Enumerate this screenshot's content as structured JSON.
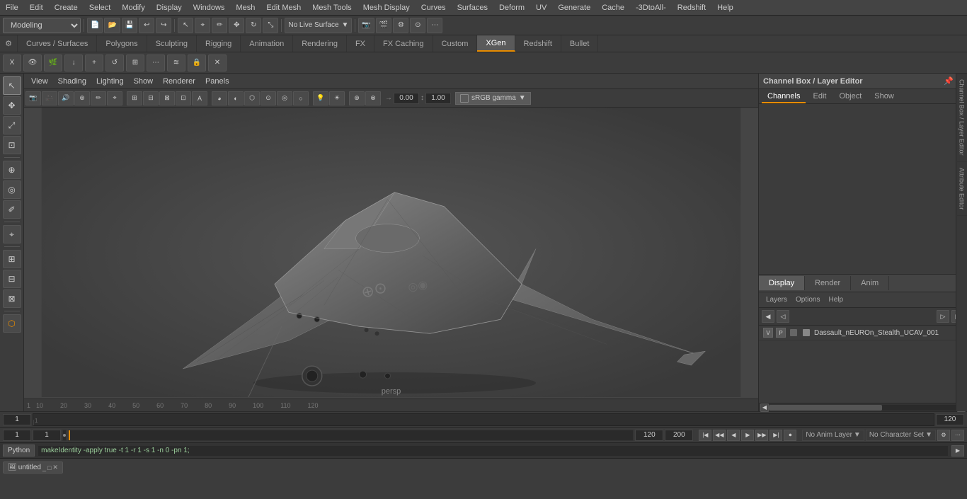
{
  "menubar": {
    "items": [
      "File",
      "Edit",
      "Create",
      "Select",
      "Modify",
      "Display",
      "Windows",
      "Mesh",
      "Edit Mesh",
      "Mesh Tools",
      "Mesh Display",
      "Curves",
      "Surfaces",
      "Deform",
      "UV",
      "Generate",
      "Cache",
      "-3DtoAll-",
      "Redshift",
      "Help"
    ]
  },
  "toolbar1": {
    "mode_label": "Modeling",
    "live_surface": "No Live Surface"
  },
  "tabbar": {
    "tabs": [
      "Curves / Surfaces",
      "Polygons",
      "Sculpting",
      "Rigging",
      "Animation",
      "Rendering",
      "FX",
      "FX Caching",
      "Custom",
      "XGen",
      "Redshift",
      "Bullet"
    ],
    "active_tab": "XGen"
  },
  "xgen_toolbar": {
    "buttons": [
      "X",
      "eye",
      "leaf",
      "arrow-down",
      "plus",
      "rotate",
      "layers",
      "scatter",
      "wave",
      "lock",
      "x-close"
    ]
  },
  "viewport": {
    "menus": [
      "View",
      "Shading",
      "Lighting",
      "Show",
      "Renderer",
      "Panels"
    ],
    "camera_label": "persp",
    "coord_x": "0.00",
    "coord_y": "1.00",
    "color_profile": "sRGB gamma"
  },
  "channel_box": {
    "title": "Channel Box / Layer Editor",
    "tabs": [
      "Channels",
      "Edit",
      "Object",
      "Show"
    ],
    "active_tab": "Channels"
  },
  "layer_editor": {
    "display_tab": "Display",
    "render_tab": "Render",
    "anim_tab": "Anim",
    "active_tab": "Display",
    "menus": [
      "Layers",
      "Options",
      "Help"
    ],
    "layer_item": {
      "v": "V",
      "p": "P",
      "name": "Dassault_nEUROn_Stealth_UCAV_001"
    }
  },
  "timeline": {
    "start": "1",
    "end": "120",
    "end2": "120",
    "end3": "200"
  },
  "playback": {
    "current_frame": "1",
    "frame2": "1",
    "range_end": "120",
    "range_end2": "200",
    "no_anim_layer": "No Anim Layer",
    "no_character_set": "No Character Set",
    "buttons": [
      "|◀",
      "◀◀",
      "◀",
      "▶",
      "▶▶",
      "▶|",
      "▶●"
    ]
  },
  "python": {
    "label": "Python",
    "command": "makeIdentity -apply true -t 1 -r 1 -s 1 -n 0 -pn 1;"
  },
  "bottom_window": {
    "name": "untitled",
    "controls": [
      "minimize",
      "restore",
      "close"
    ]
  },
  "status_bar": {
    "items": [
      "1",
      "1",
      "1"
    ]
  }
}
